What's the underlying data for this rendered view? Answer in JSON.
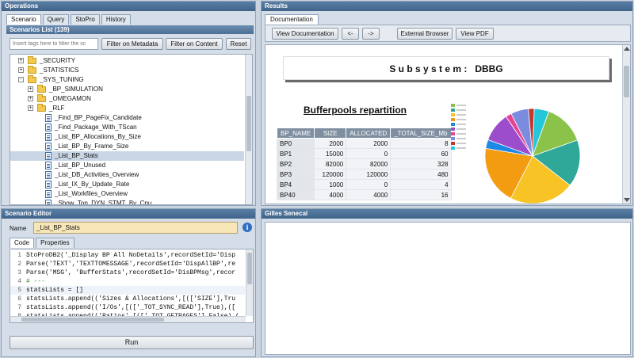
{
  "operations": {
    "title": "Operations",
    "tabs": [
      "Scenario",
      "Query",
      "StoPro",
      "History"
    ],
    "list_title": "Scenarios List (139)",
    "filter_placeholder": "Insert tags here to filter the sc",
    "btn_meta": "Filter on Metadata",
    "btn_content": "Filter on Content",
    "btn_reset": "Reset",
    "tree": [
      {
        "label": "_SECURITY",
        "type": "folder",
        "toggle": "+"
      },
      {
        "label": "_STATISTICS",
        "type": "folder",
        "toggle": "+"
      },
      {
        "label": "_SYS_TUNING",
        "type": "folder",
        "toggle": "-"
      },
      {
        "label": "_BP_SIMULATION",
        "type": "folder",
        "toggle": "+"
      },
      {
        "label": "_OMEGAMON",
        "type": "folder",
        "toggle": "+"
      },
      {
        "label": "_RLF",
        "type": "folder",
        "toggle": "+"
      },
      {
        "label": "_Find_BP_PageFix_Candidate",
        "type": "doc"
      },
      {
        "label": "_Find_Package_With_TScan",
        "type": "doc"
      },
      {
        "label": "_List_BP_Allocations_By_Size",
        "type": "doc"
      },
      {
        "label": "_List_BP_By_Frame_Size",
        "type": "doc"
      },
      {
        "label": "_List_BP_Stats",
        "type": "doc",
        "selected": true
      },
      {
        "label": "_List_BP_Unused",
        "type": "doc"
      },
      {
        "label": "_List_DB_Activities_Overview",
        "type": "doc"
      },
      {
        "label": "_List_IX_By_Update_Rate",
        "type": "doc"
      },
      {
        "label": "_List_Workfiles_Overview",
        "type": "doc"
      },
      {
        "label": "_Show_Top_DYN_STMT_By_Cpu",
        "type": "doc"
      }
    ]
  },
  "editor": {
    "title": "Scenario Editor",
    "name_label": "Name",
    "name_value": "_List_BP_Stats",
    "tabs": [
      "Code",
      "Properties"
    ],
    "code_lines": [
      {
        "n": "1",
        "text": "StoProDB2('_Display BP All NoDetails',recordSetId='Disp"
      },
      {
        "n": "2",
        "text": "Parse('TEXT','TEXTTOMESSAGE',recordSetId='DispAllBP',re"
      },
      {
        "n": "3",
        "text": "Parse('MSG', 'BufferStats',recordSetId='DisBPMsg',recor"
      },
      {
        "n": "4",
        "text": "# ---"
      },
      {
        "n": "5",
        "text": "statsLists = []"
      },
      {
        "n": "6",
        "text": "statsLists.append(('Sizes & Allocations',[(['SIZE'],Tru"
      },
      {
        "n": "7",
        "text": "statsLists.append(('I/Os',[(['_TOT_SYNC_READ'],True),(["
      },
      {
        "n": "8",
        "text": "statsLists.append(('Ratios',[(['_TOT_GETPAGES'],False),("
      }
    ],
    "run_label": "Run"
  },
  "results": {
    "title": "Results",
    "tab": "Documentation",
    "btn_view_doc": "View Documentation",
    "btn_back": "<-",
    "btn_fwd": "->",
    "btn_external": "External Browser",
    "btn_pdf": "View PDF",
    "subsystem": "S u b s y s t e m :   DBBG",
    "section_title": "Bufferpools repartition",
    "table_headers": [
      "BP_NAME",
      "SIZE",
      "ALLOCATED",
      "_TOTAL_SIZE_Mb"
    ],
    "table_rows": [
      [
        "BP0",
        "2000",
        "2000",
        "8"
      ],
      [
        "BP1",
        "15000",
        "0",
        "60"
      ],
      [
        "BP2",
        "82000",
        "82000",
        "328"
      ],
      [
        "BP3",
        "120000",
        "120000",
        "480"
      ],
      [
        "BP4",
        "1000",
        "0",
        "4"
      ],
      [
        "BP40",
        "4000",
        "4000",
        "16"
      ]
    ],
    "pie_colors": [
      "#8bc34a",
      "#2fa89a",
      "#f7c325",
      "#f39c12",
      "#1e88e5",
      "#9c4dcc",
      "#e84393",
      "#7b8cde",
      "#c0392b",
      "#26c6da"
    ]
  },
  "gilles": {
    "title": "Gilles Senecal"
  }
}
